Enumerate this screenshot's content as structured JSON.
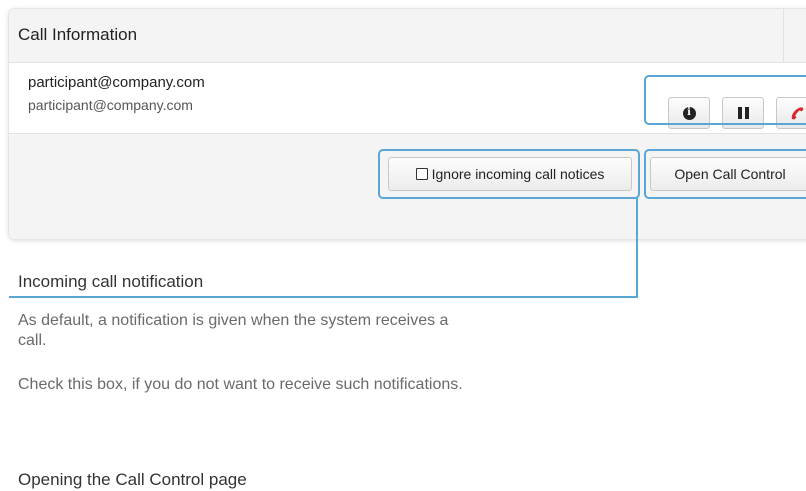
{
  "dialog": {
    "title": "Call Information",
    "close_glyph": "×",
    "participant": {
      "name": "participant@company.com",
      "uri": "participant@company.com"
    },
    "actions": [
      {
        "icon": "info-icon",
        "label": "Call details"
      },
      {
        "icon": "pause-icon",
        "label": "Hold call"
      },
      {
        "icon": "end-call-icon",
        "label": "End call",
        "color": "#d8292f"
      }
    ],
    "footer": {
      "ignore_label": "Ignore incoming call notices",
      "ignore_checked": false,
      "open_label": "Open Call Control"
    }
  },
  "docs": {
    "incoming_heading": "Incoming call notification",
    "incoming_paragraphs": [
      "As default, a notification is given when the system receives a call.",
      "Check this box, if you do not want to receive such notifications."
    ],
    "opening_heading": "Opening the Call Control page"
  },
  "colors": {
    "highlight": "#5aa7d6",
    "panel_bg": "#f4f4f4",
    "end_call": "#d8292f"
  }
}
